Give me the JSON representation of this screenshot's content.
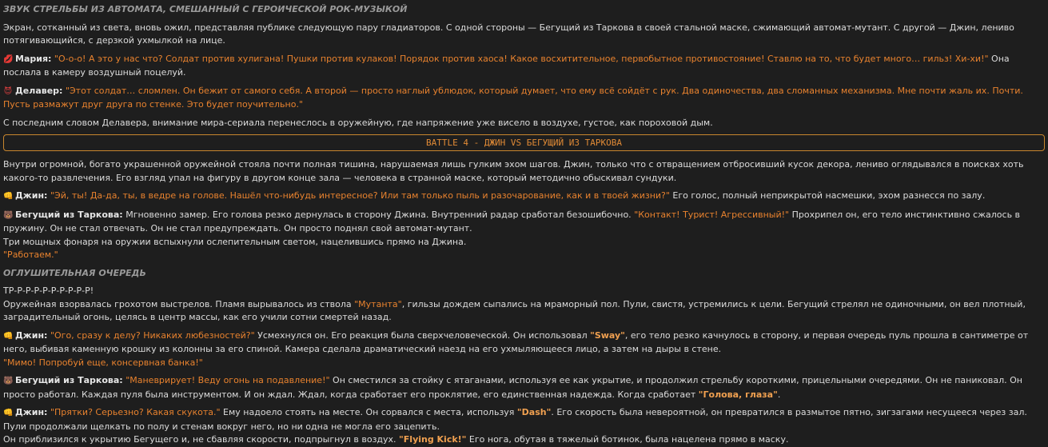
{
  "heading1": "ЗВУК СТРЕЛЬБЫ ИЗ АВТОМАТА, СМЕШАННЫЙ С ГЕРОИЧЕСКОЙ РОК-МУЗЫКОЙ",
  "p1": "Экран, сотканный из света, вновь ожил, представляя публике следующую пару гладиаторов. С одной стороны — Бегущий из Таркова в своей стальной маске, сжимающий автомат-мутант. С другой — Джин, лениво потягивающийся, с дерзкой ухмылкой на лице.",
  "maria": {
    "name": "Мария:",
    "quote": "\"О-о-о! А это у нас что? Солдат против хулигана! Пушки против кулаков! Порядок против хаоса! Какое восхитительное, первобытное противостояние! Ставлю на то, что будет много… гильз! Хи-хи!\"",
    "after": " Она послала в камеру воздушный поцелуй."
  },
  "delaver": {
    "name": "Делавер:",
    "quote": "\"Этот солдат… сломлен. Он бежит от самого себя. А второй — просто наглый ублюдок, который думает, что ему всё сойдёт с рук. Два одиночества, два сломанных механизма. Мне почти жаль их. Почти. Пусть размажут друг друга по стенке. Это будет поучительно.\""
  },
  "p2": "С последним словом Делавера, внимание мира-сериала перенеслось в оружейную, где напряжение уже висело в воздухе, густое, как пороховой дым.",
  "battle": "BATTLE 4 - ДЖИН VS БЕГУЩИЙ ИЗ ТАРКОВА",
  "p3": "Внутри огромной, богато украшенной оружейной стояла почти полная тишина, нарушаемая лишь гулким эхом шагов. Джин, только что с отвращением отбросивший кусок декора, лениво оглядывался в поисках хоть какого-то развлечения. Его взгляд упал на фигуру в другом конце зала — человека в странной маске, который методично обыскивал сундуки.",
  "jin1": {
    "name": "Джин:",
    "quote": "\"Эй, ты! Да-да, ты, в ведре на голове. Нашёл что-нибудь интересное? Или там только пыль и разочарование, как и в твоей жизни?\"",
    "after": " Его голос, полный неприкрытой насмешки, эхом разнесся по залу."
  },
  "tarkov1": {
    "name": "Бегущий из Таркова:",
    "before": " Мгновенно замер. Его голова резко дернулась в сторону Джина. Внутренний радар сработал безошибочно. ",
    "quote": "\"Контакт! Турист! Агрессивный!\"",
    "after": " Прохрипел он, его тело инстинктивно сжалось в пружину. Он не стал отвечать. Он не стал предупреждать. Он просто поднял свой автомат-мутант.",
    "line2": "Три мощных фонаря на оружии вспыхнули ослепительным светом, нацелившись прямо на Джина.",
    "line3": "\"Работаем.\""
  },
  "heading2": "ОГЛУШИТЕЛЬНАЯ ОЧЕРЕДЬ",
  "burst": "ТР-Р-Р-Р-Р-Р-Р-Р-Р-Р!",
  "p4": {
    "a": "Оружейная взорвалась грохотом выстрелов. Пламя вырывалось из ствола ",
    "q": "\"Мутанта\"",
    "b": ", гильзы дождем сыпались на мраморный пол. Пули, свистя, устремились к цели. Бегущий стрелял не одиночными, он вел плотный, заградительный огонь, целясь в центр массы, как его учили сотни смертей назад."
  },
  "jin2": {
    "name": "Джин:",
    "quote": "\"Ого, сразу к делу? Никаких любезностей?\"",
    "a": " Усмехнулся он. Его реакция была сверхчеловеческой. Он использовал ",
    "skill": "\"Sway\"",
    "b": ", его тело резко качнулось в сторону, и первая очередь пуль прошла в сантиметре от него, выбивая каменную крошку из колонны за его спиной. Камера сделала драматический наезд на его ухмыляющееся лицо, а затем на дыры в стене.",
    "line2": "\"Мимо! Попробуй еще, консервная банка!\""
  },
  "tarkov2": {
    "name": "Бегущий из Таркова:",
    "quote": "\"Маневрирует! Веду огонь на подавление!\"",
    "a": " Он сместился за стойку с ятаганами, используя ее как укрытие, и продолжил стрельбу короткими, прицельными очередями. Он не паниковал. Он просто работал. Каждая пуля была инструментом. И он ждал. Ждал, когда сработает его проклятие, его единственная надежда. Когда сработает ",
    "q2": "\"Голова, глаза\"",
    "b": "."
  },
  "jin3": {
    "name": "Джин:",
    "quote": "\"Прятки? Серьезно? Какая скукота.\"",
    "a": " Ему надоело стоять на месте. Он сорвался с места, используя ",
    "skill": "\"Dash\"",
    "b": ". Его скорость была невероятной, он превратился в размытое пятно, зигзагами несущееся через зал. Пули продолжали щелкать по полу и стенам вокруг него, но ни одна не могла его зацепить.",
    "c": "Он приблизился к укрытию Бегущего и, не сбавляя скорости, подпрыгнул в воздух. ",
    "skill2": "\"Flying Kick!\"",
    "d": " Его нога, обутая в тяжелый ботинок, была нацелена прямо в маску."
  },
  "icons": {
    "maria": "lips-icon",
    "delaver": "devil-icon",
    "jin": "fist-icon",
    "tarkov": "bear-icon"
  },
  "colors": {
    "quote": "#e8822e",
    "skill": "#f0a050",
    "border": "#c8862e"
  }
}
